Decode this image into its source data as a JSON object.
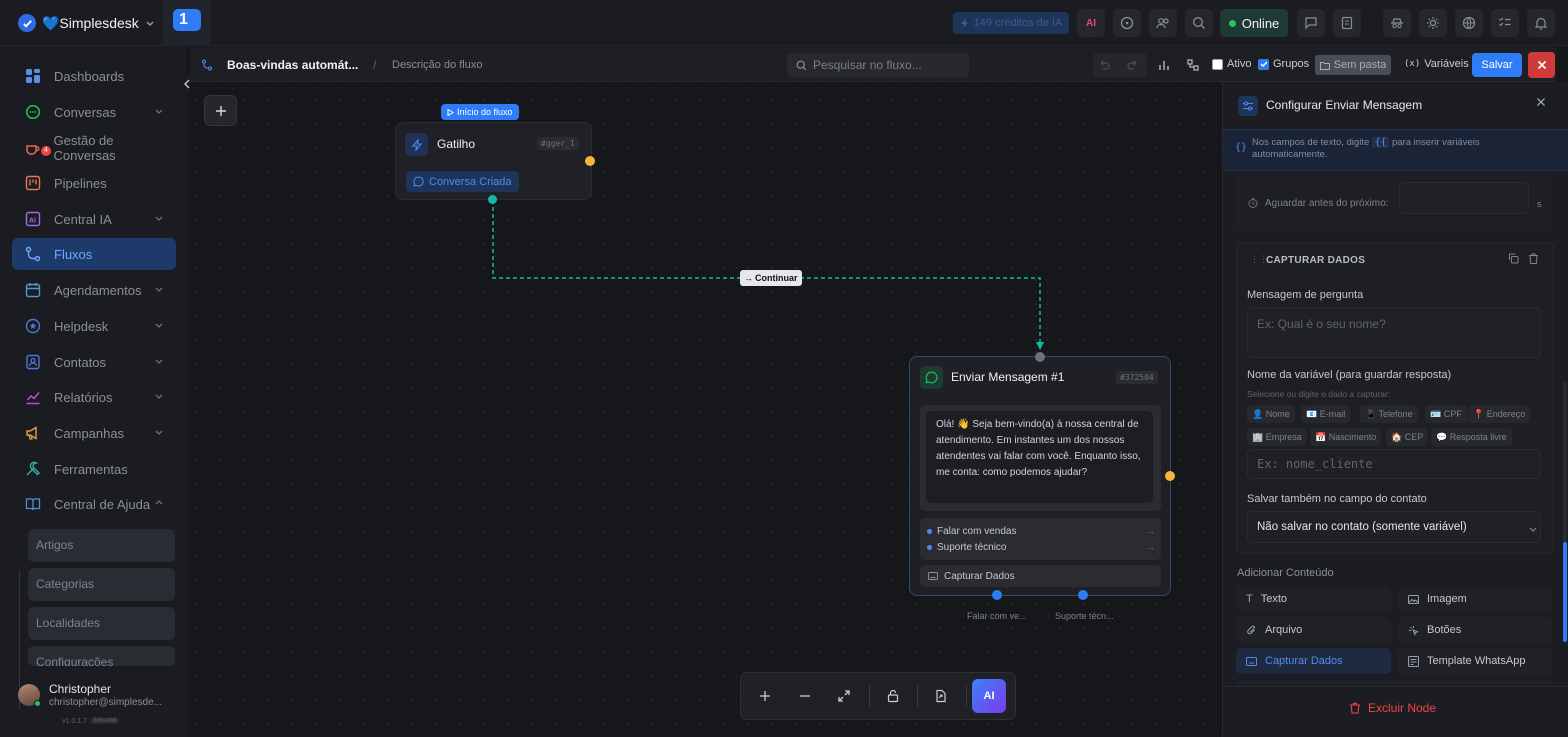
{
  "app": {
    "brand": "💙Simplesdesk",
    "tab_number": "1",
    "credits": "149 créditos de IA",
    "ai_label": "AI",
    "status": "Online"
  },
  "sidebar": {
    "items": [
      {
        "label": "Dashboards",
        "icon": "dashboard-icon"
      },
      {
        "label": "Conversas",
        "icon": "chat-icon",
        "badge": "4"
      },
      {
        "label": "Gestão de Conversas",
        "icon": "coffee-icon"
      },
      {
        "label": "Pipelines",
        "icon": "kanban-icon"
      },
      {
        "label": "Central IA",
        "icon": "ai-icon"
      },
      {
        "label": "Fluxos",
        "icon": "flow-icon"
      },
      {
        "label": "Agendamentos",
        "icon": "calendar-icon"
      },
      {
        "label": "Helpdesk",
        "icon": "star-icon"
      },
      {
        "label": "Contatos",
        "icon": "contacts-icon"
      },
      {
        "label": "Relatórios",
        "icon": "chart-icon"
      },
      {
        "label": "Campanhas",
        "icon": "megaphone-icon"
      },
      {
        "label": "Ferramentas",
        "icon": "tools-icon"
      },
      {
        "label": "Central de Ajuda",
        "icon": "book-icon"
      }
    ],
    "subitems": [
      "Artigos",
      "Categorias",
      "Localidades",
      "Configurações"
    ],
    "user": {
      "name": "Christopher",
      "email": "christopher@simplesde...",
      "version": "v1.0.1.7",
      "build": "3d0e4b8"
    }
  },
  "flowbar": {
    "title": "Boas-vindas automát...",
    "separator": "/",
    "description": "Descrição do fluxo",
    "search_placeholder": "Pesquisar no fluxo...",
    "ativo_label": "Ativo",
    "grupos_label": "Grupos",
    "pasta_label": "Sem pasta",
    "variaveis_label": "Variáveis",
    "save_label": "Salvar"
  },
  "canvas": {
    "start_badge": "Início do fluxo",
    "trigger": {
      "title": "Gatilho",
      "tag": "#gger_1",
      "event": "Conversa Criada"
    },
    "edge_label": "Continuar",
    "message_node": {
      "title": "Enviar Mensagem #1",
      "tag": "#372504",
      "text": "Olá! 👋 Seja bem-vindo(a) à nossa central de atendimento. Em instantes um dos nossos atendentes vai falar com você. Enquanto isso, me conta: como podemos ajudar?",
      "buttons": [
        "Falar com vendas",
        "Suporte técnico"
      ],
      "capture": "Capturar Dados",
      "outputs": [
        "Falar com ve...",
        "Suporte técn..."
      ]
    }
  },
  "panel": {
    "title": "Configurar Enviar Mensagem",
    "hint_prefix": "Nos campos de texto, digite",
    "hint_braces": "{{",
    "hint_suffix": "para inserir variáveis automaticamente.",
    "wait_label": "Aguardar antes do próximo:",
    "wait_unit": "s",
    "section_title": "CAPTURAR DADOS",
    "question_label": "Mensagem de pergunta",
    "question_placeholder": "Ex: Qual é o seu nome?",
    "varname_label": "Nome da variável (para guardar resposta)",
    "varname_hint": "Selecione ou digite o dado a capturar:",
    "chips": [
      "👤 Nome",
      "📧 E-mail",
      "📱 Telefone",
      "🪪 CPF",
      "📍 Endereço",
      "🏢 Empresa",
      "📅 Nascimento",
      "🏠 CEP",
      "💬 Resposta livre"
    ],
    "varname_placeholder": "Ex: nome_cliente",
    "save_contact_label": "Salvar também no campo do contato",
    "save_contact_value": "Não salvar no contato (somente variável)",
    "add_content_label": "Adicionar Conteúdo",
    "content_buttons": [
      "Texto",
      "Imagem",
      "Arquivo",
      "Botões",
      "Capturar Dados",
      "Template WhatsApp"
    ],
    "delete_label": "Excluir Node"
  },
  "colors": {
    "accent": "#2e7cf6",
    "success": "#22c55e",
    "danger": "#ef4444",
    "edge": "#14b8a6",
    "handle_out": "#f5b53d"
  }
}
